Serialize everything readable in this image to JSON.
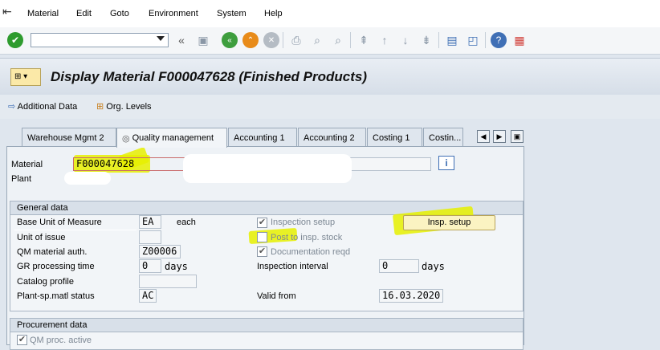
{
  "menu": {
    "items": [
      "Material",
      "Edit",
      "Goto",
      "Environment",
      "System",
      "Help"
    ]
  },
  "toolbar": {
    "command_value": "",
    "icons": [
      "confirm-icon",
      "back-icon",
      "exit-icon",
      "cancel-icon",
      "print-icon",
      "find-icon",
      "find-next-icon",
      "first-page-icon",
      "prev-page-icon",
      "next-page-icon",
      "last-page-icon",
      "new-session-icon",
      "shortcut-icon",
      "help-icon",
      "layout-icon"
    ]
  },
  "title": "Display Material F000047628 (Finished Products)",
  "appbar": {
    "additional_data": "Additional Data",
    "org_levels": "Org. Levels"
  },
  "tabs": [
    "Warehouse Mgmt 2",
    "Quality management",
    "Accounting 1",
    "Accounting 2",
    "Costing 1",
    "Costin..."
  ],
  "active_tab": 1,
  "header": {
    "material_label": "Material",
    "material_value": "F000047628",
    "plant_label": "Plant"
  },
  "general": {
    "title": "General data",
    "base_unit_label": "Base Unit of Measure",
    "base_unit_value": "EA",
    "base_unit_text": "each",
    "unit_issue_label": "Unit of issue",
    "qm_auth_label": "QM material auth.",
    "qm_auth_value": "Z00006",
    "gr_time_label": "GR processing time",
    "gr_time_value": "0",
    "gr_time_unit": "days",
    "catalog_label": "Catalog profile",
    "plant_status_label": "Plant-sp.matl status",
    "plant_status_value": "AC",
    "insp_setup_label": "Inspection setup",
    "post_insp_label": "Post to insp. stock",
    "doc_reqd_label": "Documentation reqd",
    "insp_setup_button": "Insp. setup",
    "insp_interval_label": "Inspection interval",
    "insp_interval_value": "0",
    "insp_interval_unit": "days",
    "valid_from_label": "Valid from",
    "valid_from_value": "16.03.2020"
  },
  "procurement": {
    "title": "Procurement data",
    "qm_proc_label": "QM proc. active"
  },
  "colors": {
    "highlight": "#e6f000",
    "panel": "#eef2f6"
  }
}
